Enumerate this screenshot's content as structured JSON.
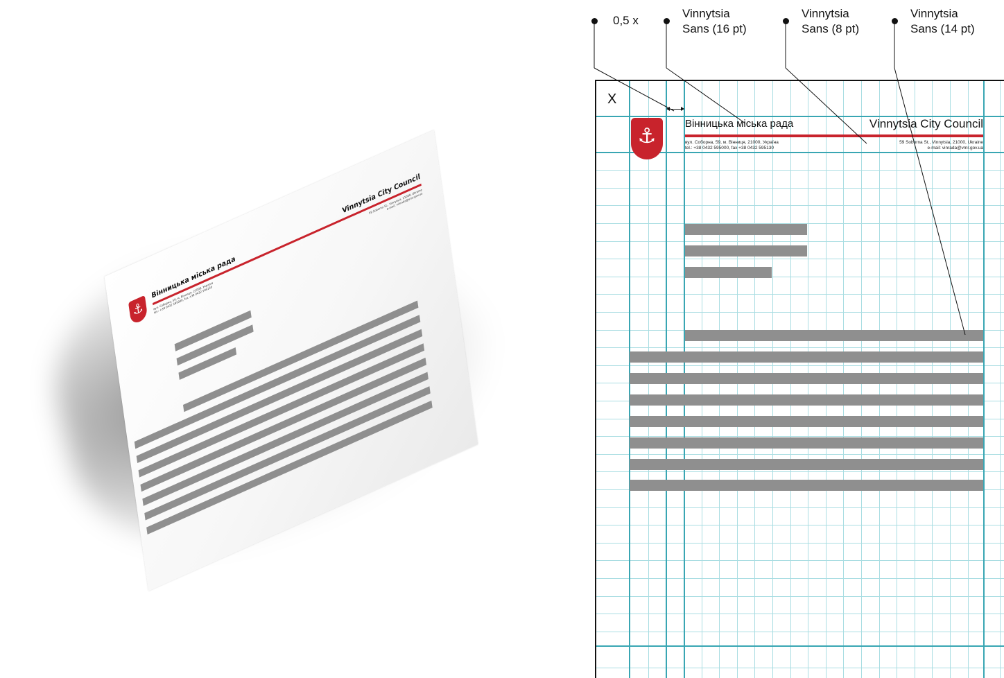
{
  "letterhead": {
    "title_ua": "Вінницька міська рада",
    "title_en": "Vinnytsia City Council",
    "address_ua_line1": "вул. Соборна, 59, м. Вінниця, 21000, Україна",
    "address_ua_line2": "tel.: +38 0432 595000, fax +38 0432 595130",
    "address_en_line1": "59 Soborna St., Vinnytsia, 21000, Ukraine",
    "address_en_line2": "e-mail: vinrada@vmr.gov.ua",
    "emblem_icon": "trident-shield-icon",
    "accent_color": "#c8232c",
    "placeholder_color": "#8f8f8f"
  },
  "spec": {
    "margin_label": "X",
    "grid_color": "#a9dde2",
    "guide_color": "#39a6b3"
  },
  "callouts": [
    {
      "line1": "0,5 x",
      "line2": ""
    },
    {
      "line1": "Vinnytsia",
      "line2": "Sans (16 pt)"
    },
    {
      "line1": "Vinnytsia",
      "line2": "Sans (8 pt)"
    },
    {
      "line1": "Vinnytsia",
      "line2": "Sans (14 pt)"
    }
  ]
}
